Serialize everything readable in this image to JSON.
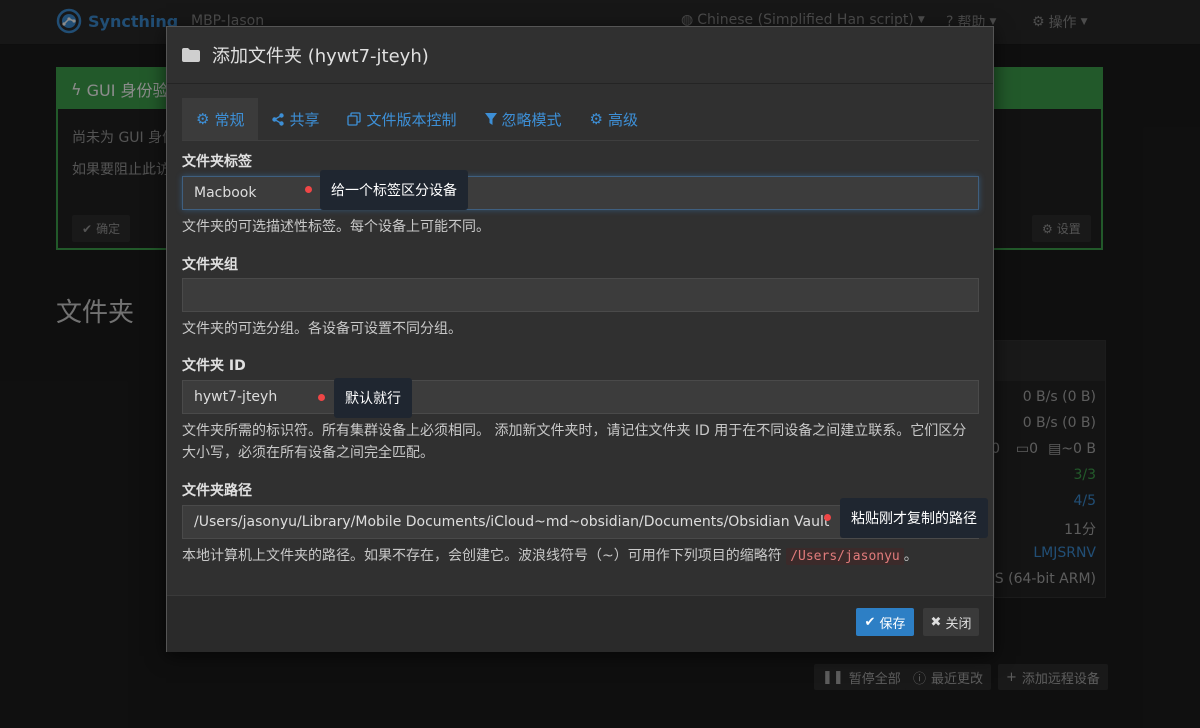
{
  "navbar": {
    "brand": "Syncthing",
    "device": "MBP-Jason",
    "language": "Chinese (Simplified Han script)",
    "help": "帮助",
    "actions": "操作"
  },
  "background": {
    "gui_panel_title": "GUI 身份验",
    "gui_line1": "尚未为 GUI 身份",
    "gui_line2": "如果要阻止此访",
    "confirm": "确定",
    "settings": "设置",
    "folders_heading": "文件夹",
    "device_rows": [
      "0 B/s (0 B)",
      "0 B/s (0 B)",
      "0",
      "0",
      "~0 B",
      "3/3",
      "4/5",
      "11分",
      "LMJSRNV",
      "S (64-bit ARM)"
    ],
    "pause_all": "暂停全部",
    "recent_changes": "最近更改",
    "add_remote": "添加远程设备"
  },
  "modal": {
    "title": "添加文件夹 (hywt7-jteyh)",
    "tabs": [
      {
        "label": "常规",
        "icon": "gear-icon"
      },
      {
        "label": "共享",
        "icon": "share-icon"
      },
      {
        "label": "文件版本控制",
        "icon": "copy-icon"
      },
      {
        "label": "忽略模式",
        "icon": "filter-icon"
      },
      {
        "label": "高级",
        "icon": "gears-icon"
      }
    ],
    "folder_label": {
      "label": "文件夹标签",
      "value": "Macbook",
      "help": "文件夹的可选描述性标签。每个设备上可能不同。"
    },
    "folder_group": {
      "label": "文件夹组",
      "value": "",
      "help": "文件夹的可选分组。各设备可设置不同分组。"
    },
    "folder_id": {
      "label": "文件夹 ID",
      "value": "hywt7-jteyh",
      "help": "文件夹所需的标识符。所有集群设备上必须相同。 添加新文件夹时，请记住文件夹 ID 用于在不同设备之间建立联系。它们区分大小写，必须在所有设备之间完全匹配。"
    },
    "folder_path": {
      "label": "文件夹路径",
      "value": "/Users/jasonyu/Library/Mobile Documents/iCloud~md~obsidian/Documents/Obsidian Vault",
      "help": "本地计算机上文件夹的路径。如果不存在，会创建它。波浪线符号（~）可用作下列项目的缩略符",
      "help_code": "/Users/jasonyu",
      "help_end": "。"
    },
    "save": "保存",
    "close": "关闭"
  },
  "annotations": {
    "label_note": "给一个标签区分设备",
    "id_note": "默认就行",
    "path_note": "粘贴刚才复制的路径"
  },
  "colors": {
    "accent": "#3d8fd6",
    "success": "#3fa34d",
    "annotation_dot": "#ef4646"
  }
}
